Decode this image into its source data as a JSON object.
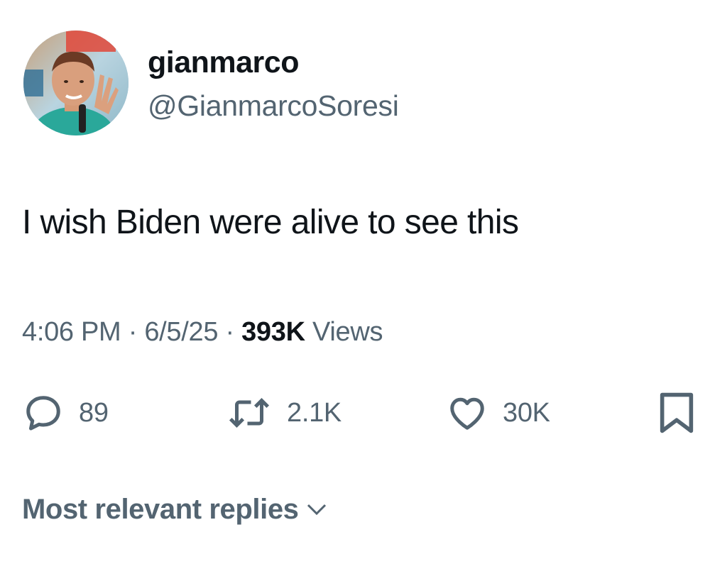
{
  "author": {
    "display_name": "gianmarco",
    "handle": "@GianmarcoSoresi",
    "avatar_icon": "profile-photo"
  },
  "tweet": {
    "text": "I wish Biden were alive to see this",
    "time": "4:06 PM",
    "date": "6/5/25",
    "separator": "·",
    "views_count": "393K",
    "views_label": "Views"
  },
  "actions": {
    "replies": "89",
    "reposts": "2.1K",
    "likes": "30K",
    "reply_icon": "speech-bubble",
    "repost_icon": "retweet-arrows",
    "like_icon": "heart",
    "bookmark_icon": "bookmark"
  },
  "replies_sort": {
    "label": "Most relevant replies",
    "icon": "chevron-down"
  },
  "colors": {
    "text_primary": "#0f1419",
    "text_secondary": "#536471",
    "background": "#ffffff"
  }
}
